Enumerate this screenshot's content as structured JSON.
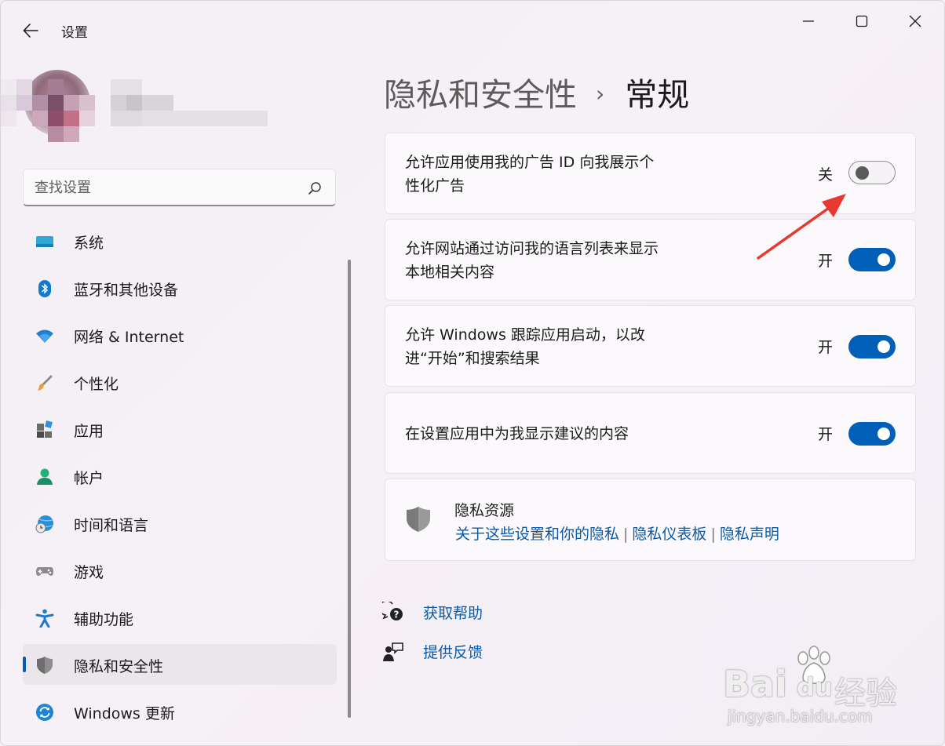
{
  "app": {
    "title": "设置"
  },
  "search": {
    "placeholder": "查找设置"
  },
  "nav": {
    "items": [
      {
        "label": "系统"
      },
      {
        "label": "蓝牙和其他设备"
      },
      {
        "label": "网络 & Internet"
      },
      {
        "label": "个性化"
      },
      {
        "label": "应用"
      },
      {
        "label": "帐户"
      },
      {
        "label": "时间和语言"
      },
      {
        "label": "游戏"
      },
      {
        "label": "辅助功能"
      },
      {
        "label": "隐私和安全性"
      },
      {
        "label": "Windows 更新"
      }
    ],
    "active_index": 9
  },
  "breadcrumb": {
    "parent": "隐私和安全性",
    "separator": "›",
    "current": "常规"
  },
  "settings": [
    {
      "line1": "允许应用使用我的广告 ID 向我展示个",
      "line2": "性化广告",
      "state": "关",
      "on": false
    },
    {
      "line1": "允许网站通过访问我的语言列表来显示",
      "line2": "本地相关内容",
      "state": "开",
      "on": true
    },
    {
      "line1": "允许 Windows 跟踪应用启动，以改",
      "line2": "进“开始”和搜索结果",
      "state": "开",
      "on": true
    },
    {
      "line1": "在设置应用中为我显示建议的内容",
      "state": "开",
      "on": true
    }
  ],
  "privacy_resources": {
    "title": "隐私资源",
    "links": [
      "关于这些设置和你的隐私",
      "隐私仪表板",
      "隐私声明"
    ],
    "separator": "|"
  },
  "help": {
    "get_help": "获取帮助",
    "feedback": "提供反馈"
  },
  "watermark": {
    "brand": "Bai",
    "brand2": "du",
    "cn": "经验",
    "url": "jingyan.baidu.com"
  },
  "colors": {
    "accent": "#005fb8",
    "link": "#0a5aa8",
    "arrow": "#e8392f"
  }
}
